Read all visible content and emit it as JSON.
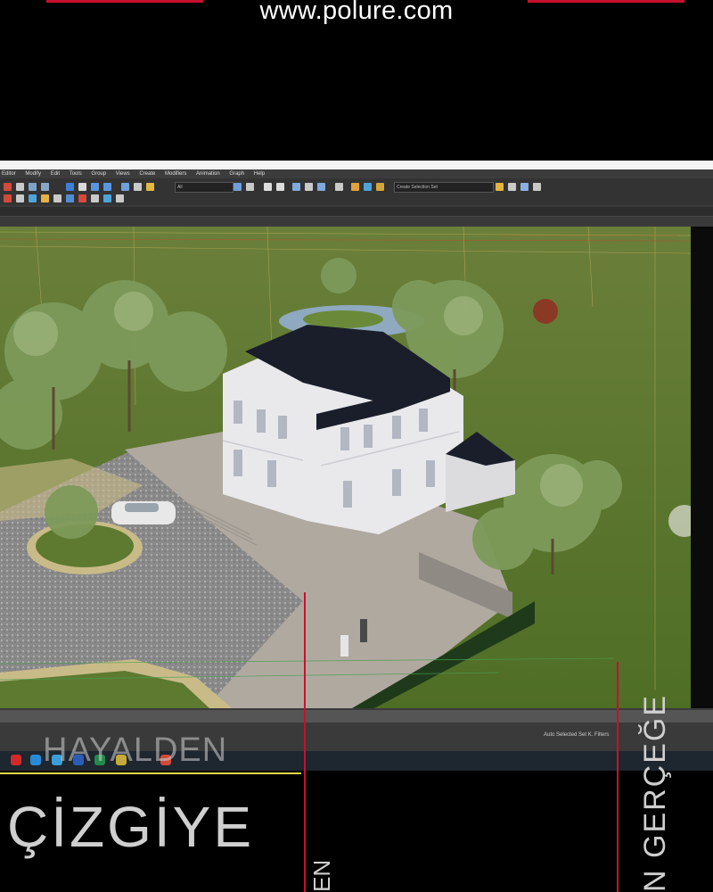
{
  "banner": {
    "url": "www.polure.com",
    "accent_color": "#c8102e"
  },
  "app": {
    "menu": [
      "Editor",
      "Modify",
      "Edit",
      "Tools",
      "Group",
      "Views",
      "Create",
      "Modifiers",
      "Animation",
      "Graph",
      "Help"
    ],
    "toolbar": {
      "view_dropdown": "All",
      "selection_set": "Create Selection Set"
    },
    "viewport": {
      "scene": "villa-3d-model",
      "ground_color": "#5a7a2c"
    },
    "status": {
      "controls": "Auto  Selected  Set K.  Filters"
    },
    "taskbar_icons": [
      "opera-icon",
      "edge-icon",
      "notepad-icon",
      "word-icon",
      "excel-icon",
      "photos-icon",
      "chrome-icon"
    ]
  },
  "overlay": {
    "word1": "HAYALDEN",
    "word2": "ÇİZGİYE",
    "word3": "EN",
    "word4": "N GERÇEĞE",
    "rule_color": "#e5d840"
  }
}
